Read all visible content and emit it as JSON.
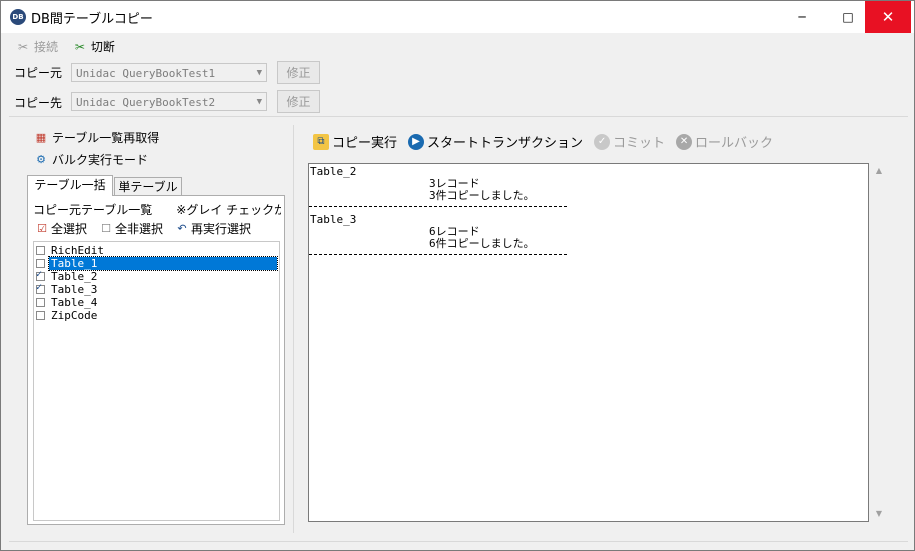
{
  "window": {
    "title": "DB間テーブルコピー",
    "icon_text": "DB",
    "min_glyph": "─",
    "max_glyph": "□",
    "close_glyph": "✕"
  },
  "connection": {
    "connect_label": "接続",
    "disconnect_label": "切断"
  },
  "source": {
    "label": "コピー元",
    "value": "Unidac QueryBookTest1",
    "fix_label": "修正"
  },
  "dest": {
    "label": "コピー先",
    "value": "Unidac QueryBookTest2",
    "fix_label": "修正"
  },
  "left": {
    "reload_label": "テーブル一覧再取得",
    "bulk_label": "バルク実行モード",
    "tabs": [
      {
        "label": "テーブル一括",
        "active": true
      },
      {
        "label": "単テーブル",
        "active": false
      }
    ],
    "panel_heading": "コピー元テーブル一覧　　※グレイ チェックが",
    "select_all": "全選択",
    "deselect_all": "全非選択",
    "reselect": "再実行選択",
    "tables": [
      {
        "name": "RichEdit",
        "checked": false,
        "selected": false
      },
      {
        "name": "Table_1",
        "checked": false,
        "selected": true
      },
      {
        "name": "Table_2",
        "checked": true,
        "selected": false
      },
      {
        "name": "Table_3",
        "checked": true,
        "selected": false
      },
      {
        "name": "Table_4",
        "checked": false,
        "selected": false
      },
      {
        "name": "ZipCode",
        "checked": false,
        "selected": false
      }
    ]
  },
  "right": {
    "copy_exec": "コピー実行",
    "start_tx": "スタートトランザクション",
    "commit": "コミット",
    "rollback": "ロールバック"
  },
  "log": {
    "entries": [
      {
        "table": "Table_2",
        "records": "3レコード",
        "copied": "3件コピーしました。"
      },
      {
        "table": "Table_3",
        "records": "6レコード",
        "copied": "6件コピーしました。"
      }
    ]
  },
  "colors": {
    "selection": "#0078d7",
    "close_button": "#e81123"
  }
}
